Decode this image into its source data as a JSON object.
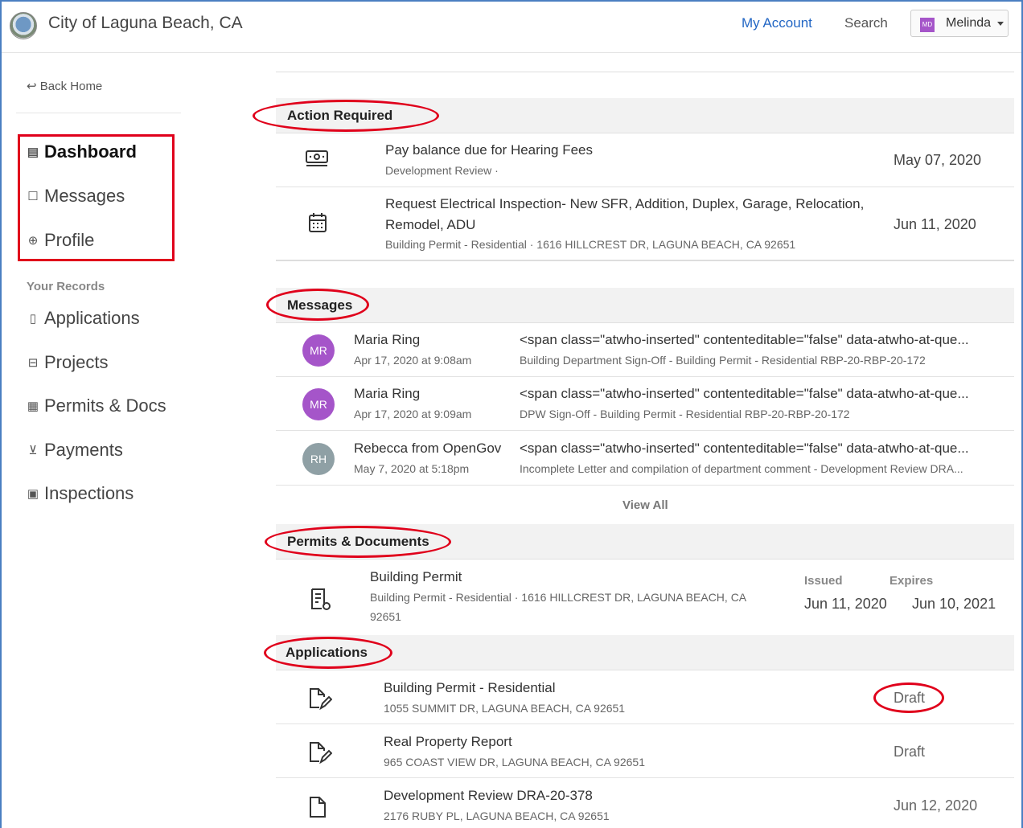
{
  "header": {
    "site_title": "City of Laguna Beach, CA",
    "my_account": "My Account",
    "search": "Search",
    "user_initials": "MD",
    "user_name": "Melinda"
  },
  "sidebar": {
    "back_home": "Back Home",
    "nav": [
      {
        "label": "Dashboard",
        "icon": "dashboard-icon"
      },
      {
        "label": "Messages",
        "icon": "inbox-icon"
      },
      {
        "label": "Profile",
        "icon": "user-circle-icon"
      }
    ],
    "records_heading": "Your Records",
    "records": [
      {
        "label": "Applications",
        "icon": "document-icon"
      },
      {
        "label": "Projects",
        "icon": "briefcase-icon"
      },
      {
        "label": "Permits & Docs",
        "icon": "certificate-icon"
      },
      {
        "label": "Payments",
        "icon": "cart-icon"
      },
      {
        "label": "Inspections",
        "icon": "clipboard-icon"
      }
    ]
  },
  "action_required": {
    "title": "Action Required",
    "items": [
      {
        "title": "Pay balance due for Hearing Fees",
        "subtitle": "Development Review ·",
        "date": "May 07, 2020",
        "icon": "money-icon"
      },
      {
        "title_line1": "Request Electrical Inspection- New SFR, Addition, Duplex, Garage, Relocation,",
        "title_line2": "Remodel, ADU",
        "subtitle": "Building Permit - Residential · 1616 HILLCREST DR, LAGUNA BEACH, CA 92651",
        "date": "Jun 11, 2020",
        "icon": "calendar-icon"
      }
    ]
  },
  "messages": {
    "title": "Messages",
    "items": [
      {
        "initials": "MR",
        "avatar_color": "#a555c9",
        "sender": "Maria Ring",
        "time": "Apr 17, 2020 at 9:08am",
        "preview": "<span class=\"atwho-inserted\" contenteditable=\"false\" data-atwho-at-que...",
        "context": "Building Department Sign-Off - Building Permit - Residential RBP-20-RBP-20-172"
      },
      {
        "initials": "MR",
        "avatar_color": "#a555c9",
        "sender": "Maria Ring",
        "time": "Apr 17, 2020 at 9:09am",
        "preview": "<span class=\"atwho-inserted\" contenteditable=\"false\" data-atwho-at-que...",
        "context": "DPW Sign-Off - Building Permit - Residential RBP-20-RBP-20-172"
      },
      {
        "initials": "RH",
        "avatar_color": "#8fa0a5",
        "sender": "Rebecca from OpenGov",
        "time": "May 7, 2020 at 5:18pm",
        "preview": "<span class=\"atwho-inserted\" contenteditable=\"false\" data-atwho-at-que...",
        "context": "Incomplete Letter and compilation of department comment - Development Review DRA..."
      }
    ],
    "view_all": "View All"
  },
  "permits": {
    "title": "Permits & Documents",
    "items": [
      {
        "title": "Building Permit",
        "subtitle_line1": "Building Permit - Residential · 1616 HILLCREST DR, LAGUNA BEACH, CA",
        "subtitle_line2": "92651",
        "issued_label": "Issued",
        "issued": "Jun 11, 2020",
        "expires_label": "Expires",
        "expires": "Jun 10, 2021",
        "icon": "permit-icon"
      }
    ]
  },
  "applications": {
    "title": "Applications",
    "items": [
      {
        "title": "Building Permit - Residential",
        "subtitle": "1055 SUMMIT DR, LAGUNA BEACH, CA 92651",
        "status": "Draft",
        "icon": "edit-document-icon"
      },
      {
        "title": "Real Property Report",
        "subtitle": "965 COAST VIEW DR, LAGUNA BEACH, CA 92651",
        "status": "Draft",
        "icon": "edit-document-icon"
      },
      {
        "title": "Development Review DRA-20-378",
        "subtitle": "2176 RUBY PL, LAGUNA BEACH, CA 92651",
        "status": "Jun 12, 2020",
        "icon": "document-icon"
      }
    ]
  },
  "colors": {
    "accent": "#2266c4",
    "annotation_red": "#e0001b",
    "frame_blue": "#4a7fc1"
  }
}
